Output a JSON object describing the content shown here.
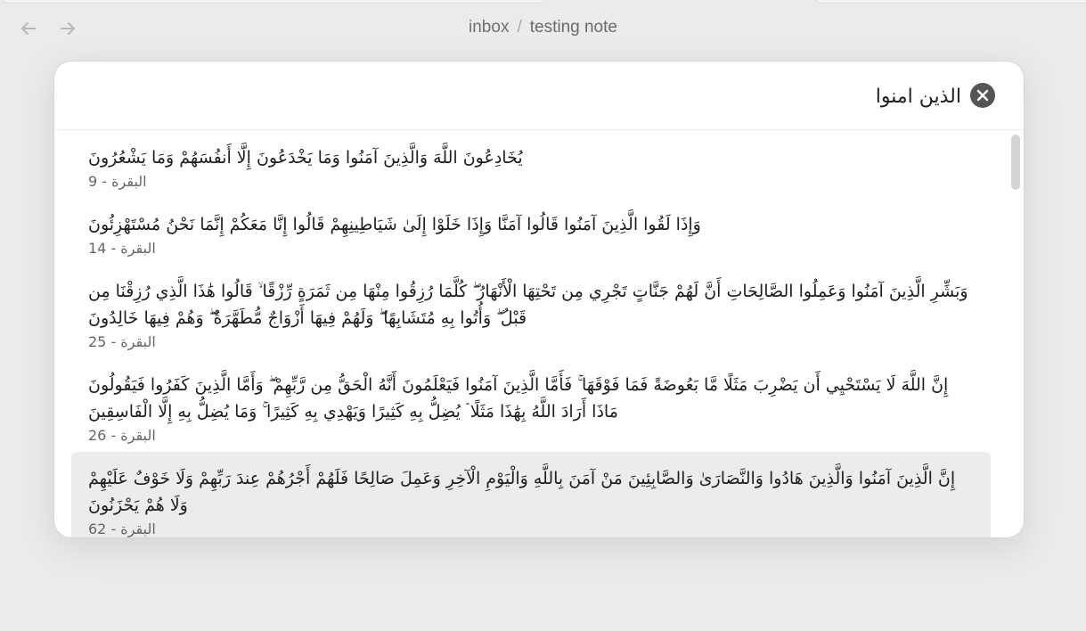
{
  "nav": {
    "back_icon": "arrow-left-icon",
    "forward_icon": "arrow-right-icon"
  },
  "breadcrumb": {
    "parent": "inbox",
    "separator": "/",
    "current": "testing note"
  },
  "search": {
    "value": "الذين امنوا",
    "clear_icon": "close-circle-icon"
  },
  "results": [
    {
      "text": "يُخَادِعُونَ اللَّهَ وَالَّذِينَ آمَنُوا وَمَا يَخْدَعُونَ إِلَّا أَنفُسَهُمْ وَمَا يَشْعُرُونَ",
      "ref": "البقرة - 9"
    },
    {
      "text": "وَإِذَا لَقُوا الَّذِينَ آمَنُوا قَالُوا آمَنَّا وَإِذَا خَلَوْا إِلَىٰ شَيَاطِينِهِمْ قَالُوا إِنَّا مَعَكُمْ إِنَّمَا نَحْنُ مُسْتَهْزِئُونَ",
      "ref": "البقرة - 14"
    },
    {
      "text": "وَبَشِّرِ الَّذِينَ آمَنُوا وَعَمِلُوا الصَّالِحَاتِ أَنَّ لَهُمْ جَنَّاتٍ تَجْرِي مِن تَحْتِهَا الْأَنْهَارُ ۖ كُلَّمَا رُزِقُوا مِنْهَا مِن ثَمَرَةٍ رِّزْقًا ۙ قَالُوا هَٰذَا الَّذِي رُزِقْنَا مِن قَبْلُ ۖ وَأُتُوا بِهِ مُتَشَابِهًا ۖ وَلَهُمْ فِيهَا أَزْوَاجٌ مُّطَهَّرَةٌ ۖ وَهُمْ فِيهَا خَالِدُونَ",
      "ref": "البقرة - 25"
    },
    {
      "text": "إِنَّ اللَّهَ لَا يَسْتَحْيِي أَن يَضْرِبَ مَثَلًا مَّا بَعُوضَةً فَمَا فَوْقَهَا ۚ فَأَمَّا الَّذِينَ آمَنُوا فَيَعْلَمُونَ أَنَّهُ الْحَقُّ مِن رَّبِّهِمْ ۖ وَأَمَّا الَّذِينَ كَفَرُوا فَيَقُولُونَ مَاذَا أَرَادَ اللَّهُ بِهَٰذَا مَثَلًا ۘ يُضِلُّ بِهِ كَثِيرًا وَيَهْدِي بِهِ كَثِيرًا ۚ وَمَا يُضِلُّ بِهِ إِلَّا الْفَاسِقِينَ",
      "ref": "البقرة - 26"
    },
    {
      "text": "إِنَّ الَّذِينَ آمَنُوا وَالَّذِينَ هَادُوا وَالنَّصَارَىٰ وَالصَّابِئِينَ مَنْ آمَنَ بِاللَّهِ وَالْيَوْمِ الْآخِرِ وَعَمِلَ صَالِحًا فَلَهُمْ أَجْرُهُمْ عِندَ رَبِّهِمْ وَلَا خَوْفٌ عَلَيْهِمْ وَلَا هُمْ يَحْزَنُونَ",
      "ref": "البقرة - 62"
    }
  ]
}
